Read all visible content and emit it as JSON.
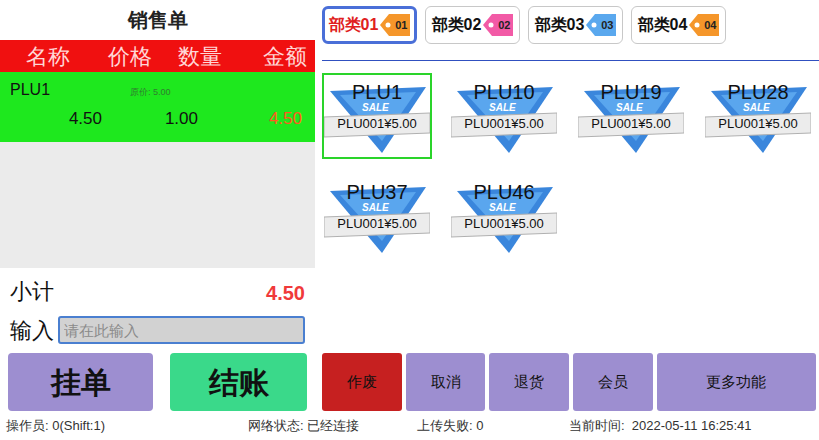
{
  "sales_order": {
    "title": "销售单",
    "columns": [
      "名称",
      "价格",
      "数量",
      "金额"
    ],
    "rows": [
      {
        "name": "PLU1",
        "original_price_label": "原价: 5.00",
        "price": "4.50",
        "quantity": "1.00",
        "amount": "4.50",
        "selected": true
      }
    ]
  },
  "subtotal": {
    "label": "小计",
    "value": "4.50"
  },
  "input": {
    "label": "输入",
    "placeholder": "请在此输入"
  },
  "left_buttons": [
    {
      "label": "挂单",
      "color": "#9d8ed0"
    },
    {
      "label": "结账",
      "color": "#3ad98a"
    }
  ],
  "categories": [
    {
      "label": "部类01",
      "tag": "01",
      "color": "#f5962a",
      "selected": true
    },
    {
      "label": "部类02",
      "tag": "02",
      "color": "#f25aa6",
      "selected": false
    },
    {
      "label": "部类03",
      "tag": "03",
      "color": "#5aa8ee",
      "selected": false
    },
    {
      "label": "部类04",
      "tag": "04",
      "color": "#f5962a",
      "selected": false
    }
  ],
  "products": [
    {
      "name": "PLU1",
      "badge": "SALE",
      "caption": "PLU001¥5.00",
      "selected": true
    },
    {
      "name": "PLU10",
      "badge": "SALE",
      "caption": "PLU001¥5.00",
      "selected": false
    },
    {
      "name": "PLU19",
      "badge": "SALE",
      "caption": "PLU001¥5.00",
      "selected": false
    },
    {
      "name": "PLU28",
      "badge": "SALE",
      "caption": "PLU001¥5.00",
      "selected": false
    },
    {
      "name": "PLU37",
      "badge": "SALE",
      "caption": "PLU001¥5.00",
      "selected": false
    },
    {
      "name": "PLU46",
      "badge": "SALE",
      "caption": "PLU001¥5.00",
      "selected": false
    }
  ],
  "actions": [
    {
      "label": "作废",
      "color": "#c62020"
    },
    {
      "label": "取消",
      "color": "#9d8ed0"
    },
    {
      "label": "退货",
      "color": "#9d8ed0"
    },
    {
      "label": "会员",
      "color": "#9d8ed0"
    },
    {
      "label": "更多功能",
      "color": "#9d8ed0"
    }
  ],
  "status_bar": {
    "operator": "操作员: 0(Shift:1)",
    "network": "网络状态: 已经连接",
    "upload": "上传失败: 0",
    "time": "当前时间:  2022-05-11 16:25:41"
  }
}
